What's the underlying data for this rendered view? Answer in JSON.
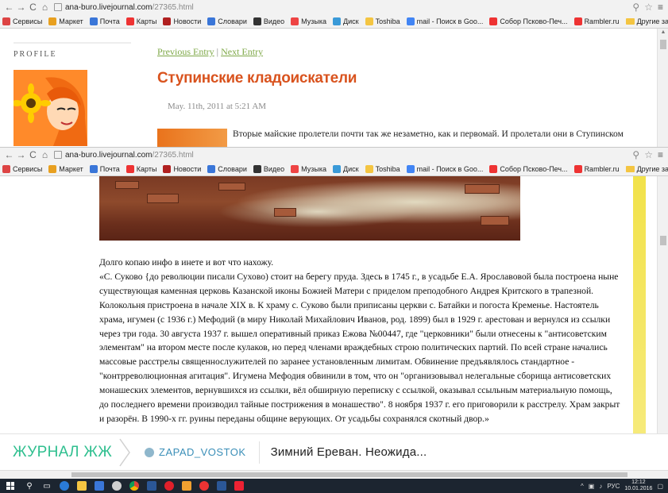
{
  "browser_top": {
    "url_host": "ana-buro.livejournal.com",
    "url_path": "/27365.html"
  },
  "browser_second": {
    "url_host": "ana-buro.livejournal.com",
    "url_path": "/27365.html"
  },
  "bookmarks": [
    {
      "label": "Сервисы",
      "color": "#d44"
    },
    {
      "label": "Маркет",
      "color": "#e8a020"
    },
    {
      "label": "Почта",
      "color": "#3a76d8"
    },
    {
      "label": "Карты",
      "color": "#e33"
    },
    {
      "label": "Новости",
      "color": "#b02020"
    },
    {
      "label": "Словари",
      "color": "#3a76d8"
    },
    {
      "label": "Видео",
      "color": "#333"
    },
    {
      "label": "Музыка",
      "color": "#e44"
    },
    {
      "label": "Диск",
      "color": "#3a9ad8"
    },
    {
      "label": "Toshiba",
      "color": "#f4c542"
    },
    {
      "label": "mail - Поиск в Goo...",
      "color": "#4285f4"
    },
    {
      "label": "Собор Псково-Печ...",
      "color": "#e33"
    },
    {
      "label": "Rambler.ru",
      "color": "#e33"
    }
  ],
  "bookmarks_other": "Другие закладки",
  "sidebar": {
    "profile_label": "PROFILE"
  },
  "entry": {
    "prev_label": "Previous Entry",
    "separator": "|",
    "next_label": "Next Entry",
    "title": "Ступинские кладоискатели",
    "date": "May. 11th, 2011 at 5:21 AM",
    "intro": "Вторые майские пролетели почти так же незаметно, как и первомай. И пролетали они в Ступинском"
  },
  "article": {
    "lead": "Долго копаю инфо в инете и вот что нахожу.",
    "quote": "«С. Суково {до революции писали Сухово) стоит на берегу пруда. Здесь в 1745 г., в усадьбе Е.А. Ярославовой была построена ныне существующая каменная церковь Казанской иконы Божией Матери с приделом преподобного Андрея Критского в трапезной. Колокольня пристроена в начале XIX в. К храму с. Суково были приписаны церкви с. Батайки и погоста Кременье. Настоятель храма, игумен (с 1936 г.) Мефодий (в миру Николай Михайлович Иванов, род. 1899) был в 1929 г. арестован и вернулся из ссылки через три года. 30 августа 1937 г. вышел оперативный приказ Ежова №00447, где \"церковники\" были отнесены к \"антисоветским элементам\" на втором месте после кулаков, но перед членами враждебных строю политических партий. По всей стране начались массовые расстрелы священнослужителей по заранее установленным лимитам. Обвинение предъявлялось стандартное - \"контрреволюционная агитация\". Игумена Мефодия обвинили в том, что он \"организовывал нелегальные сборища антисоветских монашеских элементов, вернувшихся из ссылки, вёл обширную переписку с ссылкой, оказывал ссыльным материальную помощь, до последнего времени производил тайные пострижения в монашество\". 8 ноября 1937 г. его приговорили к расстрелу. Храм закрыт и разорён. В 1990-х гг. руины переданы общине верующих. От усадьбы сохранялся скотный двор.»"
  },
  "lj_bar": {
    "logo": "ЖУРНАЛ ЖЖ",
    "username": "ZAPAD_VOSTOK",
    "post_title": "Зимний Ереван. Неожида..."
  },
  "taskbar": {
    "language": "РУС",
    "time": "12:12",
    "date": "10.01.2016"
  },
  "colors": {
    "title": "#d9531e",
    "nav_link": "#7ea847",
    "lj_logo": "#2fbf8f",
    "lj_user": "#3b8fb8"
  }
}
